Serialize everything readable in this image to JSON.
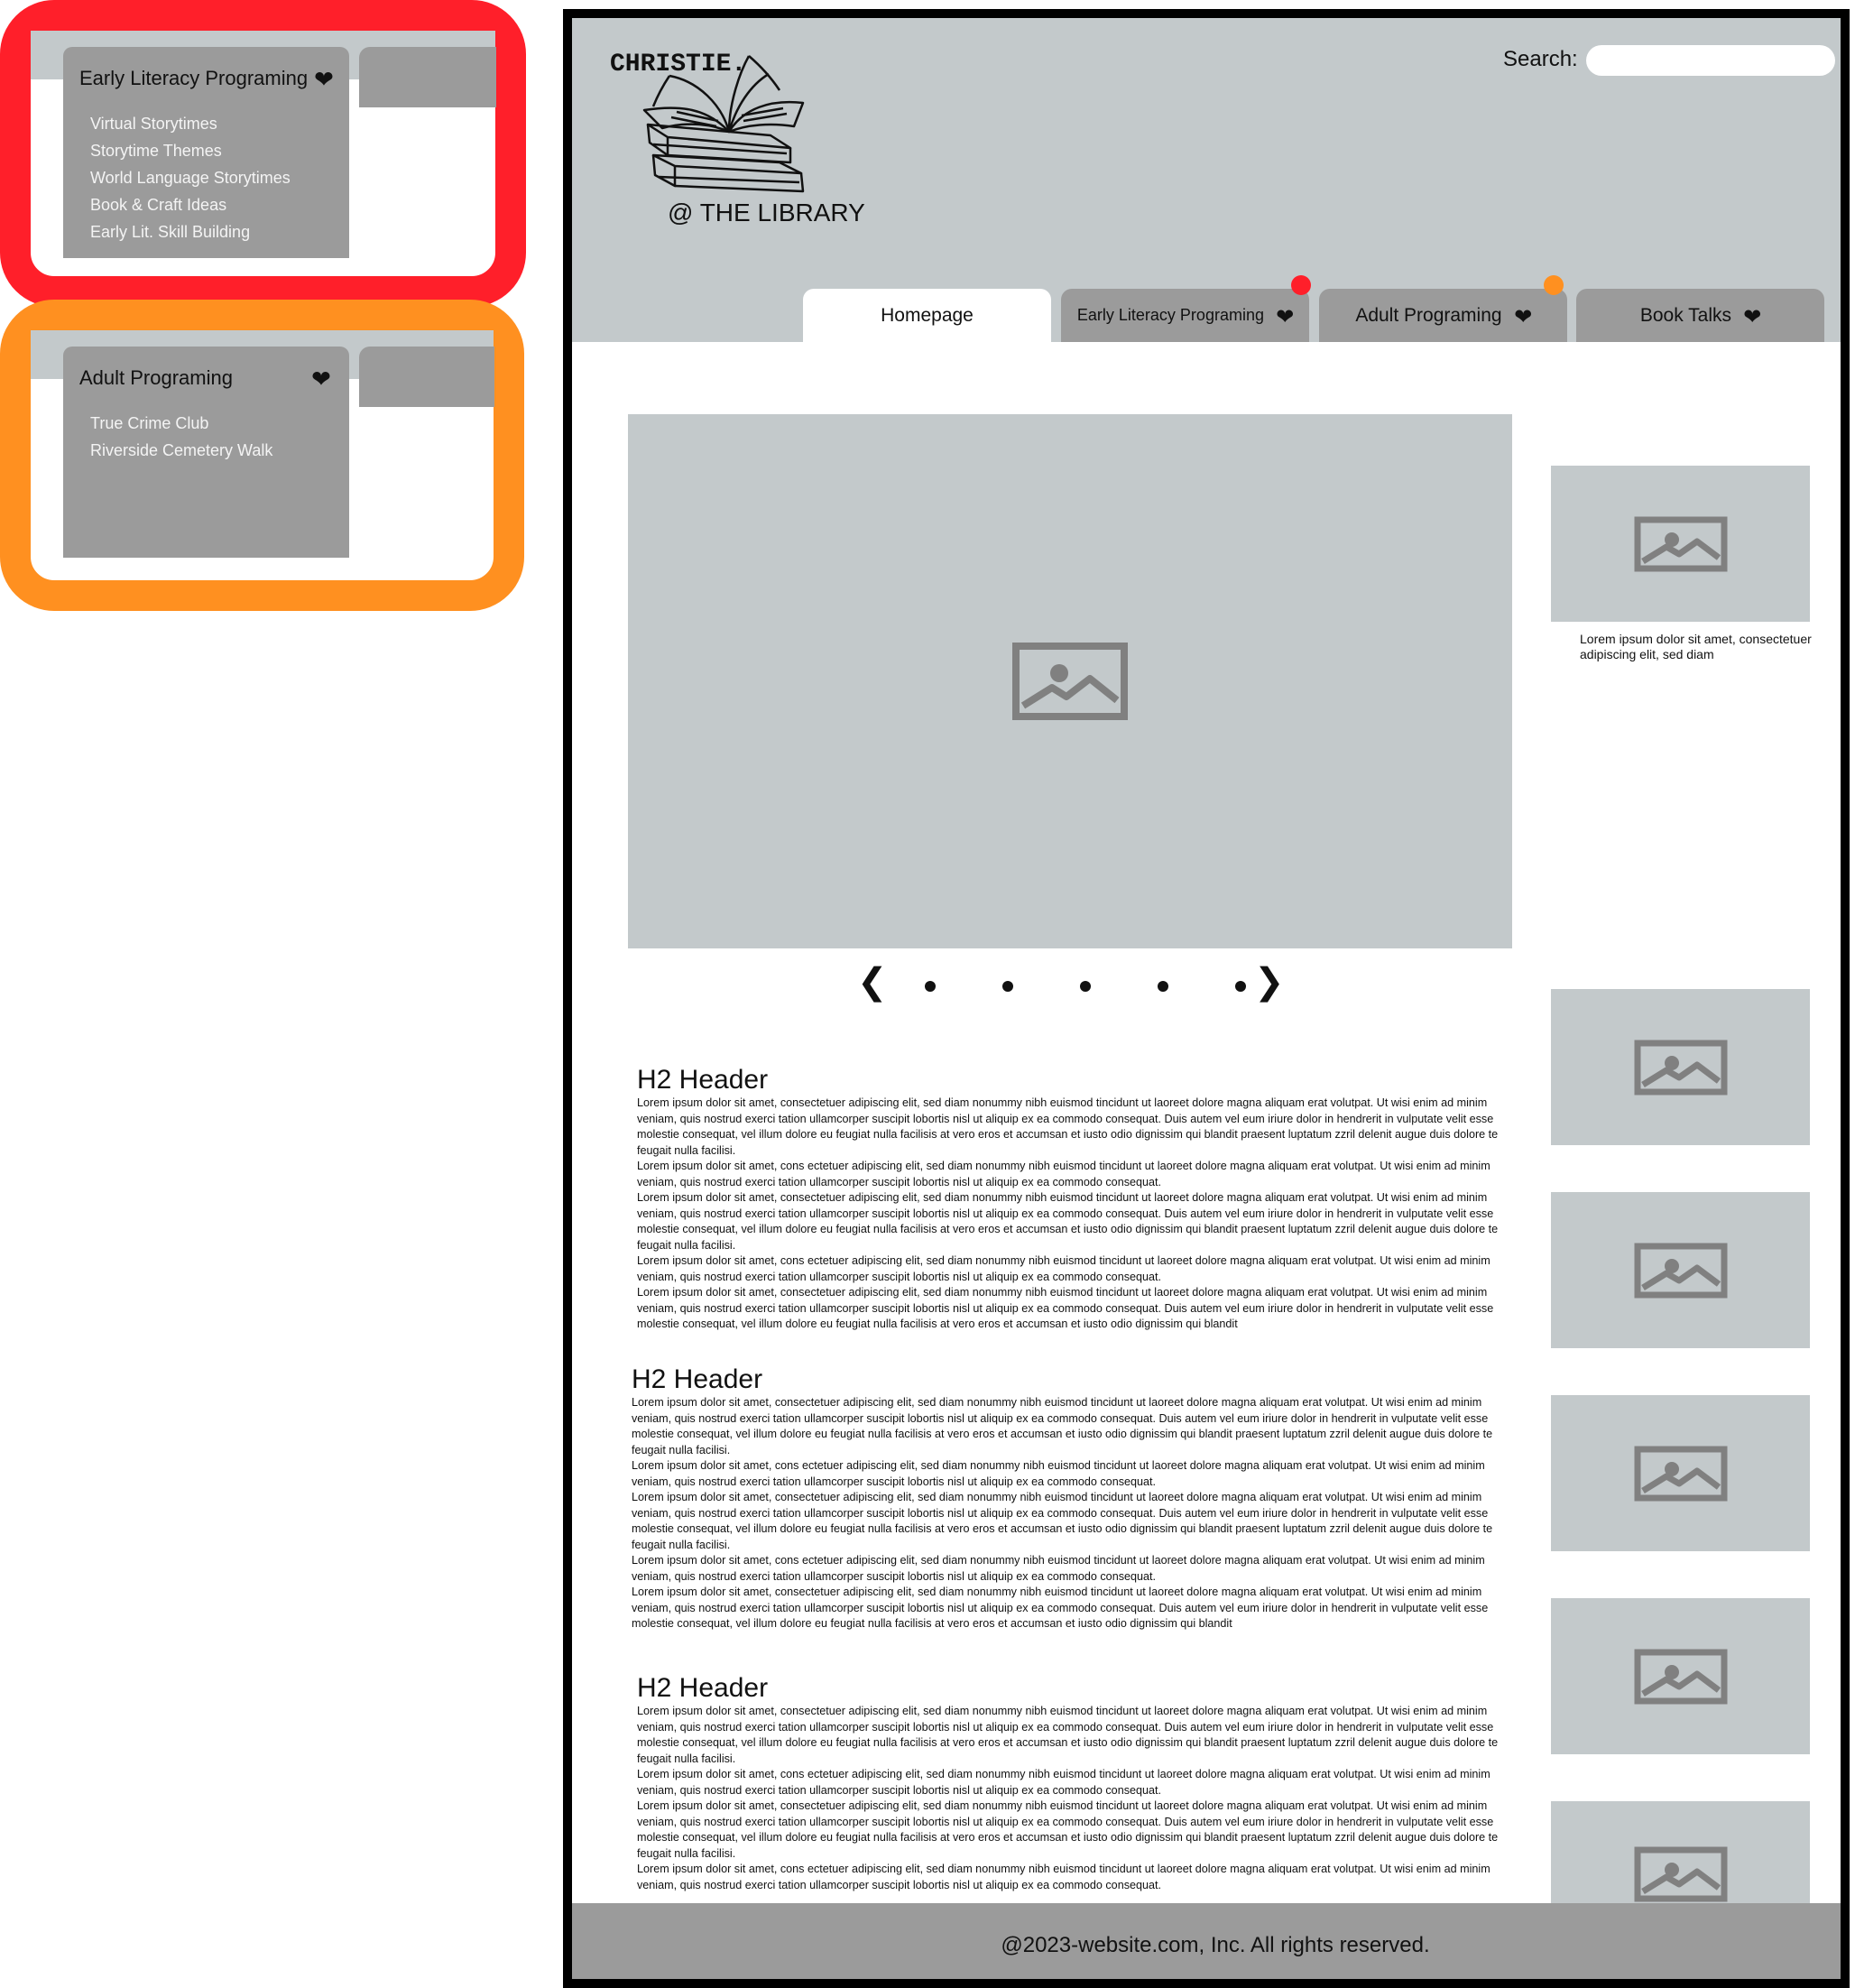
{
  "callouts": {
    "early_literacy": {
      "title": "Early Literacy Programing",
      "items": [
        "Virtual Storytimes",
        "Storytime Themes",
        "World Language Storytimes",
        "Book & Craft Ideas",
        "Early Lit. Skill Building"
      ],
      "border_color": "#ff1f2a"
    },
    "adult": {
      "title": "Adult Programing",
      "items": [
        "True Crime Club",
        "Riverside Cemetery Walk"
      ],
      "border_color": "#ff9020"
    }
  },
  "header": {
    "logo_word": "CHRISTIE.",
    "logo_sub": "@ THE LIBRARY",
    "search_label": "Search:",
    "search_value": ""
  },
  "nav": {
    "tabs": [
      {
        "label": "Homepage",
        "active": true
      },
      {
        "label": "Early Literacy Programing",
        "dot": "#ff1f2a"
      },
      {
        "label": "Adult Programing",
        "dot": "#ff9020"
      },
      {
        "label": "Book Talks"
      }
    ]
  },
  "sidebar": {
    "caption": "Lorem ipsum dolor sit amet, consectetuer adipiscing elit, sed diam"
  },
  "articles": [
    {
      "heading": "H2 Header",
      "paragraphs": [
        "Lorem ipsum dolor sit amet, consectetuer adipiscing elit, sed diam nonummy nibh euismod tincidunt ut laoreet dolore magna aliquam erat volutpat. Ut wisi enim ad minim veniam, quis nostrud exerci tation ullamcorper suscipit lobortis nisl ut aliquip ex ea commodo consequat. Duis autem vel eum iriure dolor in hendrerit in vulputate velit esse molestie consequat, vel illum dolore eu feugiat nulla facilisis at vero eros et accumsan et iusto odio dignissim qui blandit praesent luptatum zzril delenit augue duis dolore te feugait nulla facilisi.",
        "Lorem ipsum dolor sit amet, cons ectetuer adipiscing elit, sed diam nonummy nibh euismod tincidunt ut laoreet dolore magna aliquam erat volutpat. Ut wisi enim ad minim veniam, quis nostrud exerci tation ullamcorper suscipit lobortis nisl ut aliquip ex ea commodo consequat.",
        "Lorem ipsum dolor sit amet, consectetuer adipiscing elit, sed diam nonummy nibh euismod tincidunt ut laoreet dolore magna aliquam erat volutpat. Ut wisi enim ad minim veniam, quis nostrud exerci tation ullamcorper suscipit lobortis nisl ut aliquip ex ea commodo consequat. Duis autem vel eum iriure dolor in hendrerit in vulputate velit esse molestie consequat, vel illum dolore eu feugiat nulla facilisis at vero eros et accumsan et iusto odio dignissim qui blandit praesent luptatum zzril delenit augue duis dolore te feugait nulla facilisi.",
        "Lorem ipsum dolor sit amet, cons ectetuer adipiscing elit, sed diam nonummy nibh euismod tincidunt ut laoreet dolore magna aliquam erat volutpat. Ut wisi enim ad minim veniam, quis nostrud exerci tation ullamcorper suscipit lobortis nisl ut aliquip ex ea commodo consequat.",
        "Lorem ipsum dolor sit amet, consectetuer adipiscing elit, sed diam nonummy nibh euismod tincidunt ut laoreet dolore magna aliquam erat volutpat. Ut wisi enim ad minim veniam, quis nostrud exerci tation ullamcorper suscipit lobortis nisl ut aliquip ex ea commodo consequat. Duis autem vel eum iriure dolor in hendrerit in vulputate velit esse molestie consequat, vel illum dolore eu feugiat nulla facilisis at vero eros et accumsan et iusto odio dignissim qui blandit"
      ]
    },
    {
      "heading": "H2 Header",
      "paragraphs": [
        "Lorem ipsum dolor sit amet, consectetuer adipiscing elit, sed diam nonummy nibh euismod tincidunt ut laoreet dolore magna aliquam erat volutpat. Ut wisi enim ad minim veniam, quis nostrud exerci tation ullamcorper suscipit lobortis nisl ut aliquip ex ea commodo consequat. Duis autem vel eum iriure dolor in hendrerit in vulputate velit esse molestie consequat, vel illum dolore eu feugiat nulla facilisis at vero eros et accumsan et iusto odio dignissim qui blandit praesent luptatum zzril delenit augue duis dolore te feugait nulla facilisi.",
        "Lorem ipsum dolor sit amet, cons ectetuer adipiscing elit, sed diam nonummy nibh euismod tincidunt ut laoreet dolore magna aliquam erat volutpat. Ut wisi enim ad minim veniam, quis nostrud exerci tation ullamcorper suscipit lobortis nisl ut aliquip ex ea commodo consequat.",
        "Lorem ipsum dolor sit amet, consectetuer adipiscing elit, sed diam nonummy nibh euismod tincidunt ut laoreet dolore magna aliquam erat volutpat. Ut wisi enim ad minim veniam, quis nostrud exerci tation ullamcorper suscipit lobortis nisl ut aliquip ex ea commodo consequat. Duis autem vel eum iriure dolor in hendrerit in vulputate velit esse molestie consequat, vel illum dolore eu feugiat nulla facilisis at vero eros et accumsan et iusto odio dignissim qui blandit praesent luptatum zzril delenit augue duis dolore te feugait nulla facilisi.",
        "Lorem ipsum dolor sit amet, cons ectetuer adipiscing elit, sed diam nonummy nibh euismod tincidunt ut laoreet dolore magna aliquam erat volutpat. Ut wisi enim ad minim veniam, quis nostrud exerci tation ullamcorper suscipit lobortis nisl ut aliquip ex ea commodo consequat.",
        "Lorem ipsum dolor sit amet, consectetuer adipiscing elit, sed diam nonummy nibh euismod tincidunt ut laoreet dolore magna aliquam erat volutpat. Ut wisi enim ad minim veniam, quis nostrud exerci tation ullamcorper suscipit lobortis nisl ut aliquip ex ea commodo consequat. Duis autem vel eum iriure dolor in hendrerit in vulputate velit esse molestie consequat, vel illum dolore eu feugiat nulla facilisis at vero eros et accumsan et iusto odio dignissim qui blandit"
      ]
    },
    {
      "heading": "H2 Header",
      "paragraphs": [
        "Lorem ipsum dolor sit amet, consectetuer adipiscing elit, sed diam nonummy nibh euismod tincidunt ut laoreet dolore magna aliquam erat volutpat. Ut wisi enim ad minim veniam, quis nostrud exerci tation ullamcorper suscipit lobortis nisl ut aliquip ex ea commodo consequat. Duis autem vel eum iriure dolor in hendrerit in vulputate velit esse molestie consequat, vel illum dolore eu feugiat nulla facilisis at vero eros et accumsan et iusto odio dignissim qui blandit praesent luptatum zzril delenit augue duis dolore te feugait nulla facilisi.",
        "Lorem ipsum dolor sit amet, cons ectetuer adipiscing elit, sed diam nonummy nibh euismod tincidunt ut laoreet dolore magna aliquam erat volutpat. Ut wisi enim ad minim veniam, quis nostrud exerci tation ullamcorper suscipit lobortis nisl ut aliquip ex ea commodo consequat.",
        "Lorem ipsum dolor sit amet, consectetuer adipiscing elit, sed diam nonummy nibh euismod tincidunt ut laoreet dolore magna aliquam erat volutpat. Ut wisi enim ad minim veniam, quis nostrud exerci tation ullamcorper suscipit lobortis nisl ut aliquip ex ea commodo consequat. Duis autem vel eum iriure dolor in hendrerit in vulputate velit esse molestie consequat, vel illum dolore eu feugiat nulla facilisis at vero eros et accumsan et iusto odio dignissim qui blandit praesent luptatum zzril delenit augue duis dolore te feugait nulla facilisi.",
        "Lorem ipsum dolor sit amet, cons ectetuer adipiscing elit, sed diam nonummy nibh euismod tincidunt ut laoreet dolore magna aliquam erat volutpat. Ut wisi enim ad minim veniam, quis nostrud exerci tation ullamcorper suscipit lobortis nisl ut aliquip ex ea commodo consequat."
      ]
    }
  ],
  "footer": {
    "text": "@2023-website.com, Inc. All rights reserved."
  },
  "icons": {
    "chevron": "chevron-down-icon",
    "image": "image-placeholder-icon",
    "logo": "book-stack-icon",
    "carousel_prev": "chevron-left-icon",
    "carousel_next": "chevron-right-icon"
  },
  "colors": {
    "header_bg": "#c3c9cb",
    "tab_bg": "#9b9b9b",
    "footer_bg": "#9b9b9b",
    "placeholder_bg": "#c3c9cb",
    "placeholder_icon": "#808080"
  }
}
